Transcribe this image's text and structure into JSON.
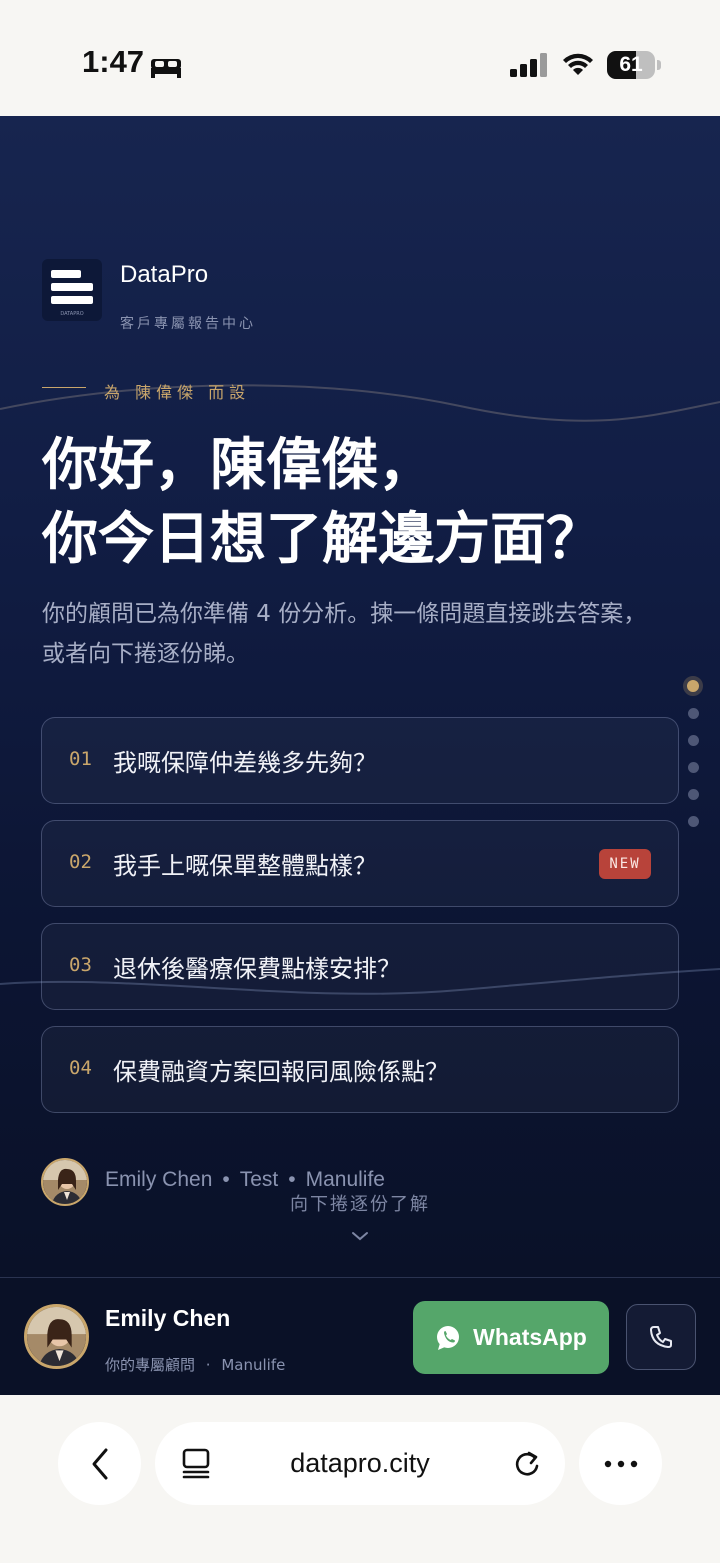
{
  "status_bar": {
    "time": "1:47",
    "battery": "61",
    "battery_level": 0.61
  },
  "brand": {
    "name": "DataPro",
    "subtitle": "客戶專屬報告中心",
    "logo_text": "DATAPRO"
  },
  "for_label": "為 陳偉傑 而設",
  "headline": {
    "line1": "你好，陳偉傑，",
    "line2": "你今日想了解邊方面？"
  },
  "intro": "你的顧問已為你準備 4 份分析。揀一條問題直接跳去答案，或者向下捲逐份睇。",
  "pager": {
    "count": 6,
    "active_index": 0
  },
  "questions": [
    {
      "num": "01",
      "text": "我嘅保障仲差幾多先夠？",
      "badge": ""
    },
    {
      "num": "02",
      "text": "我手上嘅保單整體點樣？",
      "badge": "NEW"
    },
    {
      "num": "03",
      "text": "退休後醫療保費點樣安排？",
      "badge": ""
    },
    {
      "num": "04",
      "text": "保費融資方案回報同風險係點？",
      "badge": ""
    }
  ],
  "advisor_line": {
    "name": "Emily Chen",
    "sep": "•",
    "team": "Test",
    "company": "Manulife"
  },
  "scroll_hint": "向下捲逐份了解",
  "contact": {
    "name": "Emily Chen",
    "role": "你的專屬顧問",
    "sep": "·",
    "company": "Manulife",
    "whatsapp_label": "WhatsApp"
  },
  "browser": {
    "url": "datapro.city"
  },
  "colors": {
    "navy": "#111d44",
    "gold": "#c9a66b",
    "whatsapp_green": "#55a66a",
    "badge_red": "#b8433a"
  },
  "icons": [
    "bed-icon",
    "signal-icon",
    "wifi-icon",
    "chevron-down-icon",
    "whatsapp-icon",
    "phone-icon",
    "back-icon",
    "tabs-icon",
    "reload-icon",
    "more-icon"
  ]
}
